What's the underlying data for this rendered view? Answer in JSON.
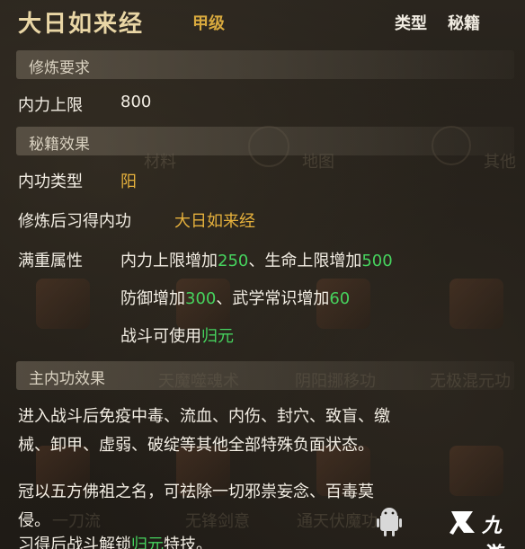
{
  "header": {
    "title": "大日如来经",
    "grade": "甲级",
    "type_label": "类型",
    "type_value": "秘籍"
  },
  "requirements": {
    "section_title": "修炼要求",
    "stat_label": "内力上限",
    "stat_value": "800"
  },
  "effects": {
    "section_title": "秘籍效果",
    "type_label": "内功类型",
    "type_value": "阳",
    "learn_label": "修炼后习得内功",
    "learn_value": "大日如来经",
    "full_label": "满重属性",
    "line1_a": "内力上限增加",
    "line1_b": "250",
    "line1_c": "、生命上限增加",
    "line1_d": "500",
    "line2_a": "防御增加",
    "line2_b": "300",
    "line2_c": "、武学常识增加",
    "line2_d": "60",
    "line3_a": "战斗可使用",
    "line3_b": "归元"
  },
  "main_effect": {
    "section_title": "主内功效果",
    "text_line1": "进入战斗后免疫中毒、流血、内伤、封穴、致盲、缴",
    "text_line2": "械、卸甲、虚弱、破绽等其他全部特殊负面状态。",
    "flavor_line1": "冠以五方佛祖之名，可祛除一切邪祟妄念、百毒莫",
    "flavor_line2": "侵。",
    "footer_a": "习得后战斗解锁",
    "footer_b": "归元",
    "footer_c": "特技。"
  },
  "watermark": {
    "text": "九游"
  }
}
